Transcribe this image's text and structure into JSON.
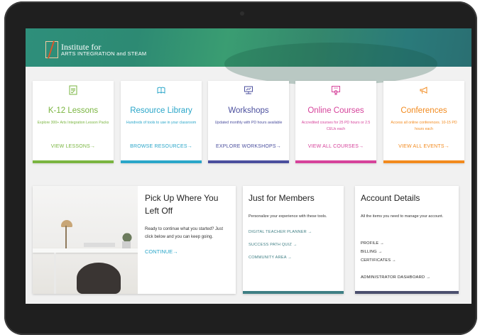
{
  "header": {
    "logo_line1": "Institute for",
    "logo_line2": "ARTS INTEGRATION and STEAM"
  },
  "cards": [
    {
      "title": "K-12 Lessons",
      "desc": "Explore 300+ Arts Integration Lesson Packs",
      "link": "VIEW LESSONS→",
      "color": "#7ab540",
      "icon": "document-check-icon"
    },
    {
      "title": "Resource Library",
      "desc": "Hundreds of tools to use in your classroom",
      "link": "BROWSE RESOURCES→",
      "color": "#2aa6c9",
      "icon": "books-icon"
    },
    {
      "title": "Workshops",
      "desc": "Updated monthly with PD hours available",
      "link": "EXPLORE WORKSHOPS→",
      "color": "#4b4f9e",
      "icon": "presentation-icon"
    },
    {
      "title": "Online Courses",
      "desc": "Accredited courses for 25 PD hours or 2.5 CEUs each",
      "link": "VIEW ALL COURSES→",
      "color": "#d6439b",
      "icon": "certificate-icon"
    },
    {
      "title": "Conferences",
      "desc": "Access all online conferences. 10-15 PD hours each",
      "link": "VIEW ALL EVENTS→",
      "color": "#f28a1e",
      "icon": "megaphone-icon"
    }
  ],
  "resume": {
    "title": "Pick Up Where You Left Off",
    "desc": "Ready to continue what you started? Just click below and you can keep going.",
    "link": "CONTINUE→"
  },
  "members": {
    "title": "Just for Members",
    "desc": "Personalize your experience with these tools.",
    "links": [
      "DIGITAL TEACHER PLANNER →",
      "SUCCESS PATH QUIZ →",
      "COMMUNITY AREA →"
    ],
    "bar_color": "#3f7f84",
    "link_color": "#3f7f84"
  },
  "account": {
    "title": "Account Details",
    "desc": "All the items you need to manage your account.",
    "links": [
      "PROFILE →",
      "BILLING →",
      "CERTIFICATES →"
    ],
    "admin_link": "ADMINISTRATOR DASHBOARD →",
    "bar_color": "#4b4f6e"
  }
}
